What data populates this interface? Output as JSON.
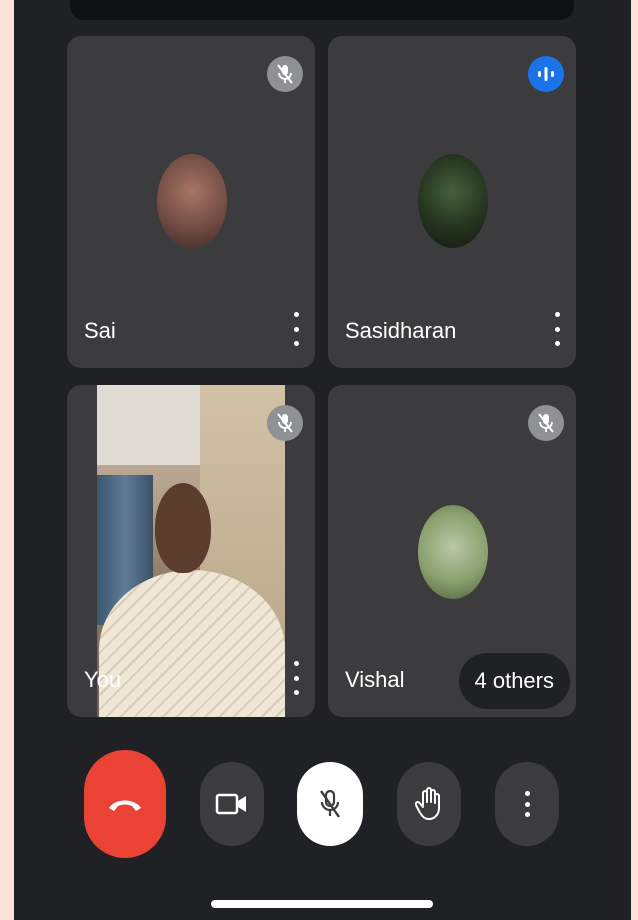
{
  "participants": [
    {
      "name": "Sai",
      "muted": true,
      "speaking": false
    },
    {
      "name": "Sasidharan",
      "muted": false,
      "speaking": true
    },
    {
      "name": "You",
      "muted": true,
      "speaking": false
    },
    {
      "name": "Vishal",
      "muted": true,
      "speaking": false
    }
  ],
  "others_label": "4 others",
  "controls": {
    "end_call": "end-call",
    "camera": "camera",
    "mic": "microphone-muted",
    "raise_hand": "raise-hand",
    "more": "more-options"
  },
  "colors": {
    "background": "#202124",
    "tile": "#3c3c3f",
    "end_call": "#ea4335",
    "speaking_badge": "#1a73e8",
    "muted_badge": "#8f9194"
  }
}
